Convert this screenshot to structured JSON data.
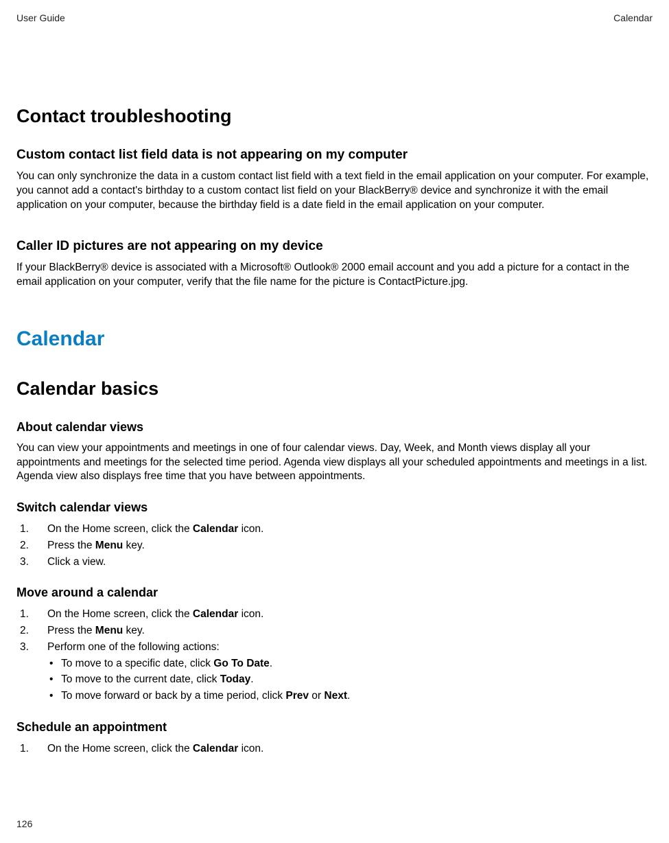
{
  "header": {
    "left": "User Guide",
    "right": "Calendar"
  },
  "section1": {
    "title": "Contact troubleshooting",
    "sub1_title": "Custom contact list field data is not appearing on my computer",
    "sub1_body": "You can only synchronize the data in a custom contact list field with a text field in the email application on your computer. For example, you cannot add a contact's birthday to a custom contact list field on your BlackBerry® device and synchronize it with the email application on your computer, because the birthday field is a date field in the email application on your computer.",
    "sub2_title": "Caller ID pictures are not appearing on my device",
    "sub2_body": "If your BlackBerry® device is associated with a Microsoft® Outlook® 2000 email account and you add a picture for a contact in the email application on your computer, verify that the file name for the picture is ContactPicture.jpg."
  },
  "chapter": {
    "title": "Calendar"
  },
  "section2": {
    "title": "Calendar basics",
    "sub1_title": "About calendar views",
    "sub1_body": "You can view your appointments and meetings in one of four calendar views. Day, Week, and Month views display all your appointments and meetings for the selected time period. Agenda view displays all your scheduled appointments and meetings in a list. Agenda view also displays free time that you have between appointments.",
    "sub2_title": "Switch calendar views",
    "sub2_steps": {
      "s1_pre": "On the Home screen, click the ",
      "s1_bold": "Calendar",
      "s1_post": " icon.",
      "s2_pre": "Press the ",
      "s2_bold": "Menu",
      "s2_post": " key.",
      "s3": "Click a view."
    },
    "sub3_title": "Move around a calendar",
    "sub3_steps": {
      "s1_pre": "On the Home screen, click the ",
      "s1_bold": "Calendar",
      "s1_post": " icon.",
      "s2_pre": "Press the ",
      "s2_bold": "Menu",
      "s2_post": " key.",
      "s3": "Perform one of the following actions:",
      "b1_pre": "To move to a specific date, click ",
      "b1_bold": "Go To Date",
      "b1_post": ".",
      "b2_pre": "To move to the current date, click ",
      "b2_bold": "Today",
      "b2_post": ".",
      "b3_pre": "To move forward or back by a time period, click ",
      "b3_bold1": "Prev",
      "b3_mid": " or ",
      "b3_bold2": "Next",
      "b3_post": "."
    },
    "sub4_title": "Schedule an appointment",
    "sub4_steps": {
      "s1_pre": "On the Home screen, click the ",
      "s1_bold": "Calendar",
      "s1_post": " icon."
    }
  },
  "footer": {
    "page_number": "126"
  }
}
